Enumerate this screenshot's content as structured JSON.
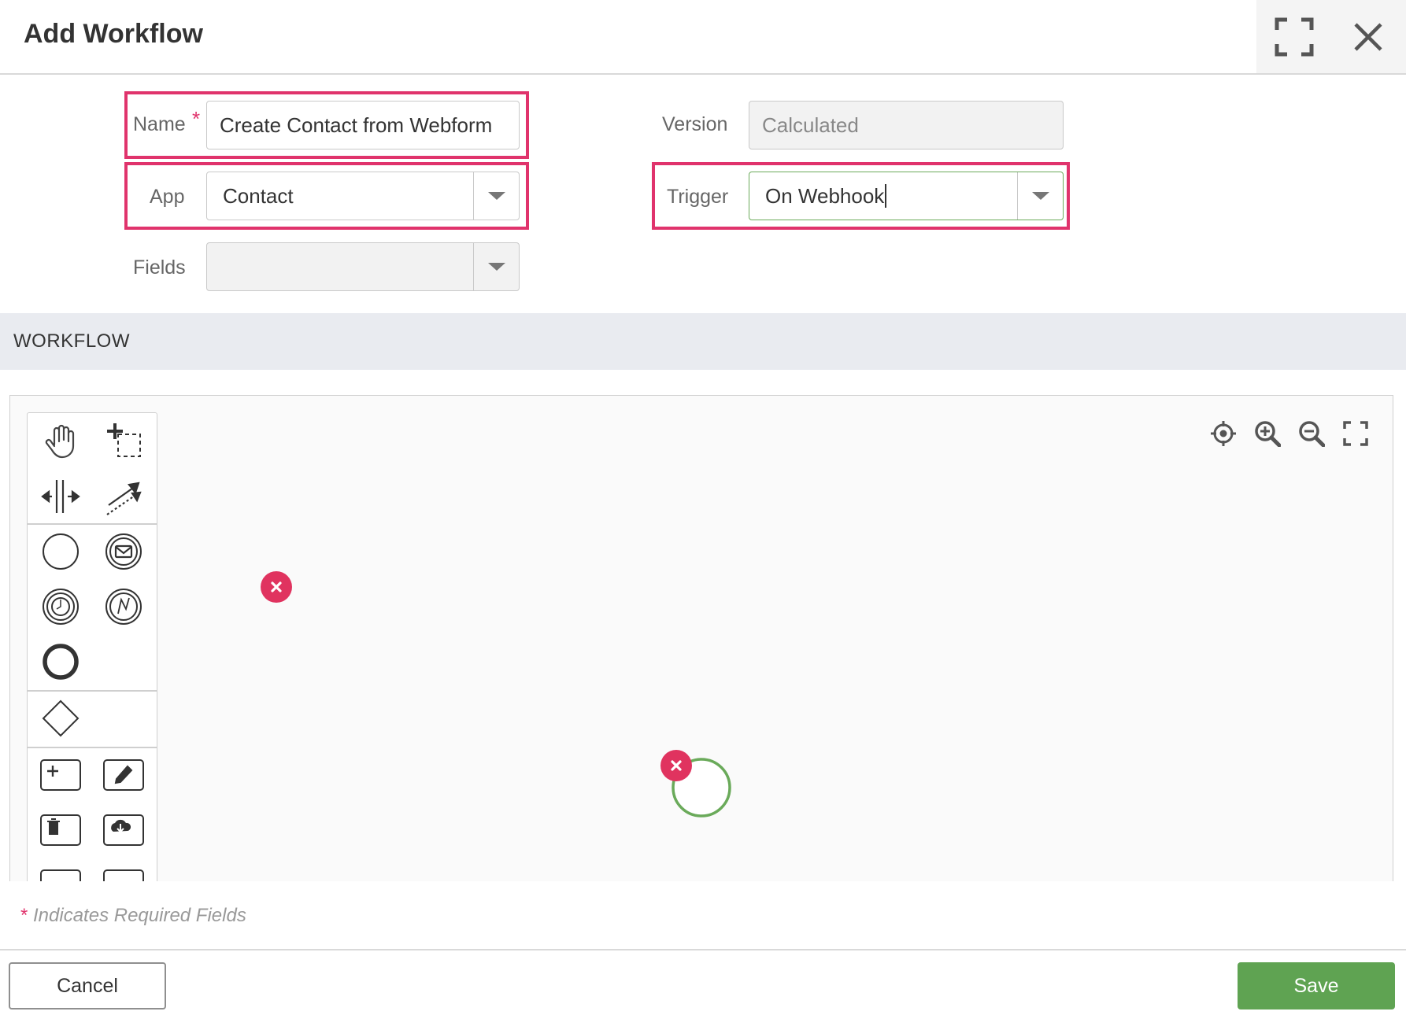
{
  "header": {
    "title": "Add Workflow",
    "fullscreen_icon": "expand-icon",
    "close_icon": "close-icon"
  },
  "form": {
    "name": {
      "label": "Name",
      "required_mark": "*",
      "value": "Create Contact from Webform"
    },
    "version": {
      "label": "Version",
      "value": "Calculated"
    },
    "app": {
      "label": "App",
      "value": "Contact"
    },
    "trigger": {
      "label": "Trigger",
      "value": "On Webhook"
    },
    "fields": {
      "label": "Fields",
      "value": ""
    }
  },
  "workflow": {
    "section_title": "WORKFLOW",
    "palette_tools": [
      "hand-tool-icon",
      "lasso-tool-icon",
      "space-tool-icon",
      "connect-tool-icon",
      "start-event-icon",
      "message-start-event-icon",
      "timer-start-event-icon",
      "signal-start-event-icon",
      "end-event-icon",
      "gateway-icon",
      "create-task-icon",
      "update-task-icon",
      "delete-task-icon",
      "download-task-icon"
    ],
    "nav_tools": [
      "recenter-icon",
      "zoom-in-icon",
      "zoom-out-icon",
      "fit-screen-icon"
    ]
  },
  "footer": {
    "required_note_mark": "*",
    "required_note": "Indicates Required Fields",
    "cancel_label": "Cancel",
    "save_label": "Save"
  },
  "colors": {
    "highlight": "#e0336c",
    "save": "#5fa352",
    "error_badge": "#e0335f",
    "start_event_stroke": "#6aaa5a"
  }
}
